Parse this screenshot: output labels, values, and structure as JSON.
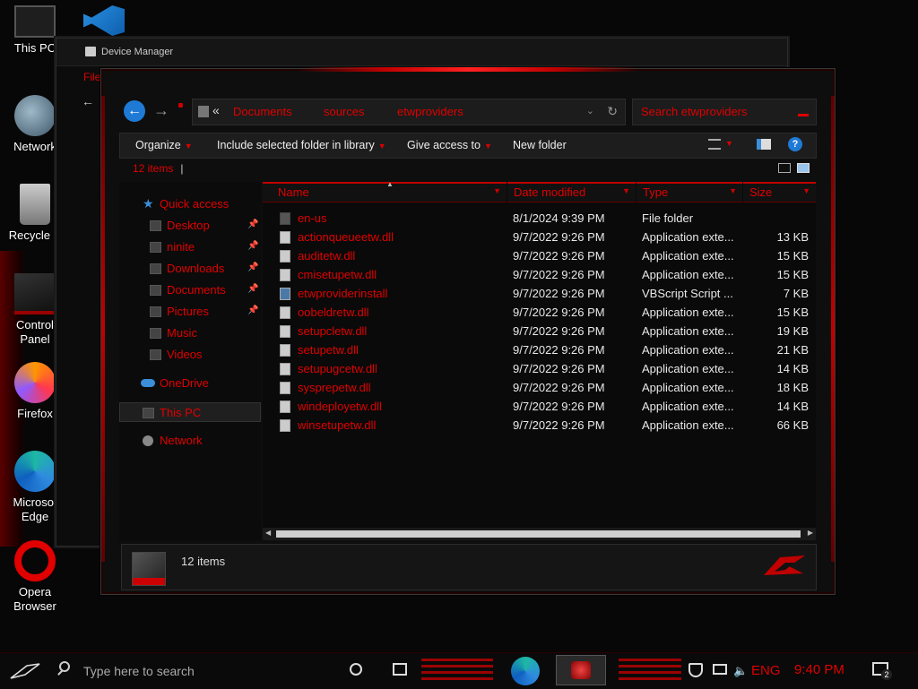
{
  "desktop": {
    "icons": [
      {
        "label": "This PC"
      },
      {
        "label": "Network"
      },
      {
        "label": "Recycle B"
      },
      {
        "label": "Control Panel"
      },
      {
        "label": "Firefox"
      },
      {
        "label": "Microsof Edge"
      },
      {
        "label": "Opera Browser"
      }
    ]
  },
  "device_manager": {
    "title": "Device Manager",
    "menu_first": "File"
  },
  "explorer": {
    "address": {
      "crumbs": [
        "Documents",
        "sources",
        "etwproviders"
      ]
    },
    "search_placeholder": "Search etwproviders",
    "toolbar": {
      "organize": "Organize",
      "include": "Include selected folder in library",
      "give_access": "Give access to",
      "new_folder": "New folder"
    },
    "item_count": "12 items",
    "nav": {
      "quick_access": "Quick access",
      "items": [
        "Desktop",
        "ninite",
        "Downloads",
        "Documents",
        "Pictures",
        "Music",
        "Videos"
      ],
      "onedrive": "OneDrive",
      "this_pc": "This PC",
      "network": "Network"
    },
    "columns": {
      "name": "Name",
      "date": "Date modified",
      "type": "Type",
      "size": "Size"
    },
    "files": [
      {
        "name": "en-us",
        "date": "8/1/2024 9:39 PM",
        "type": "File folder",
        "size": "",
        "kind": "folder"
      },
      {
        "name": "actionqueueetw.dll",
        "date": "9/7/2022 9:26 PM",
        "type": "Application exte...",
        "size": "13 KB",
        "kind": "dll"
      },
      {
        "name": "auditetw.dll",
        "date": "9/7/2022 9:26 PM",
        "type": "Application exte...",
        "size": "15 KB",
        "kind": "dll"
      },
      {
        "name": "cmisetupetw.dll",
        "date": "9/7/2022 9:26 PM",
        "type": "Application exte...",
        "size": "15 KB",
        "kind": "dll"
      },
      {
        "name": "etwproviderinstall",
        "date": "9/7/2022 9:26 PM",
        "type": "VBScript Script ...",
        "size": "7 KB",
        "kind": "vbs"
      },
      {
        "name": "oobeldretw.dll",
        "date": "9/7/2022 9:26 PM",
        "type": "Application exte...",
        "size": "15 KB",
        "kind": "dll"
      },
      {
        "name": "setupcletw.dll",
        "date": "9/7/2022 9:26 PM",
        "type": "Application exte...",
        "size": "19 KB",
        "kind": "dll"
      },
      {
        "name": "setupetw.dll",
        "date": "9/7/2022 9:26 PM",
        "type": "Application exte...",
        "size": "21 KB",
        "kind": "dll"
      },
      {
        "name": "setupugcetw.dll",
        "date": "9/7/2022 9:26 PM",
        "type": "Application exte...",
        "size": "14 KB",
        "kind": "dll"
      },
      {
        "name": "sysprepetw.dll",
        "date": "9/7/2022 9:26 PM",
        "type": "Application exte...",
        "size": "18 KB",
        "kind": "dll"
      },
      {
        "name": "windeployetw.dll",
        "date": "9/7/2022 9:26 PM",
        "type": "Application exte...",
        "size": "14 KB",
        "kind": "dll"
      },
      {
        "name": "winsetupetw.dll",
        "date": "9/7/2022 9:26 PM",
        "type": "Application exte...",
        "size": "66 KB",
        "kind": "dll"
      }
    ],
    "details_count": "12 items"
  },
  "taskbar": {
    "search_placeholder": "Type here to search",
    "language": "ENG",
    "time": "9:40 PM",
    "notification_count": "2"
  },
  "colors": {
    "accent_red": "#e00000",
    "edge_blue": "#1f7ad6"
  }
}
